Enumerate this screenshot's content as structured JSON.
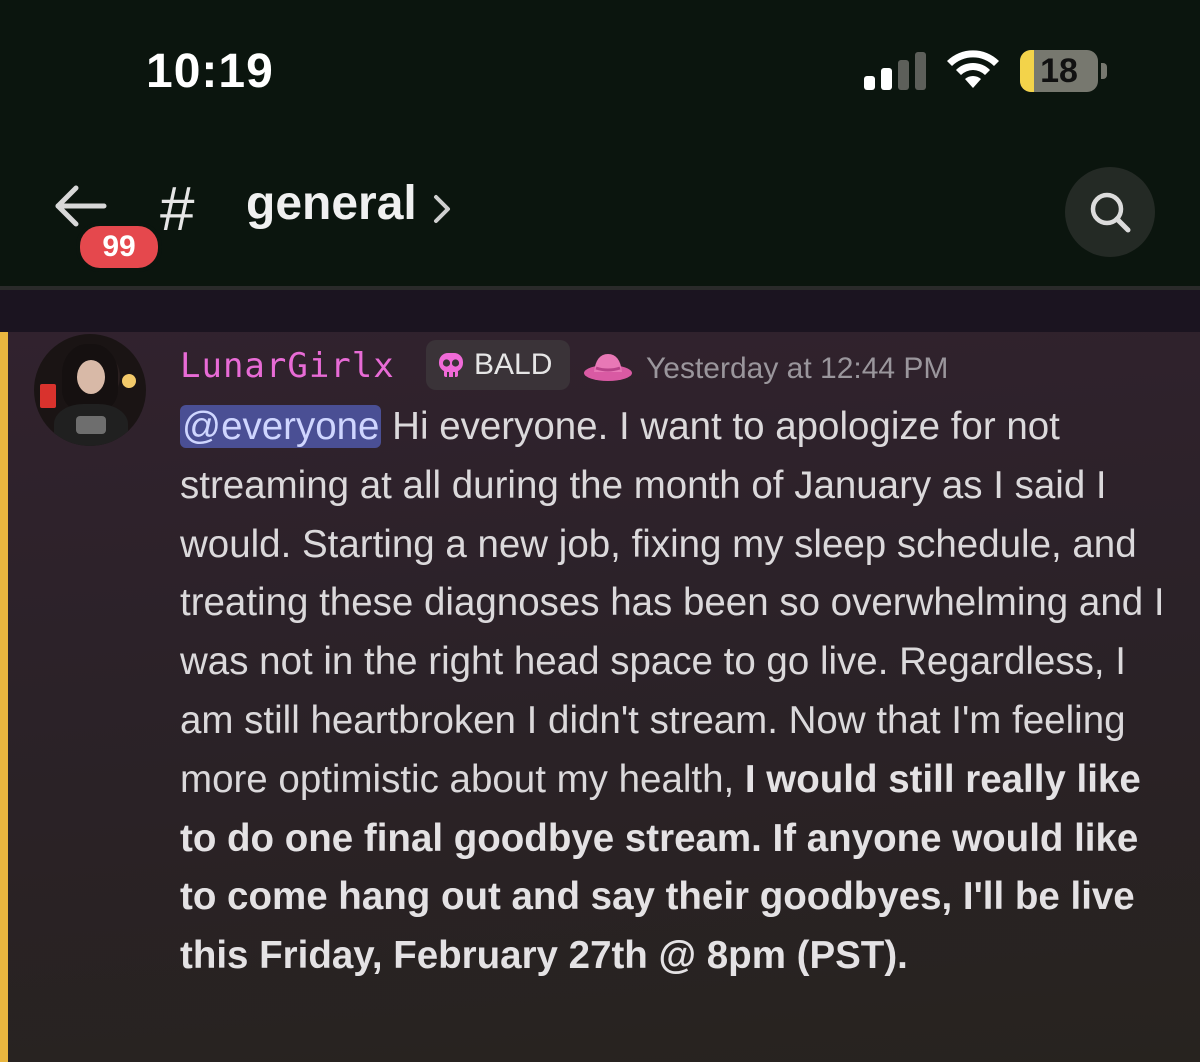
{
  "status_bar": {
    "time": "10:19",
    "battery_percent": "18",
    "signal_bars_active": 2,
    "signal_bars_total": 4
  },
  "header": {
    "unread_badge": "99",
    "channel_hash": "#",
    "channel_name": "general",
    "icons": [
      "back-arrow-icon",
      "chevron-right-icon",
      "search-icon"
    ]
  },
  "message": {
    "username": "LunarGirlx",
    "role_tag": "BALD",
    "timestamp": "Yesterday at 12:44 PM",
    "mention": "@everyone",
    "text_regular": " Hi everyone. I want to apologize for not streaming at all during the month of January as I said I would. Starting a new job, fixing my sleep schedule, and treating these diagnoses has been so overwhelming and I was not in the right head space to go live. Regardless, I am still heartbroken I didn't stream. Now that I'm feeling more optimistic about my health, ",
    "text_bold": "I would still really like to do one final goodbye stream. If anyone would like to come hang out and say their goodbyes, I'll be live this Friday, February 27th @ 8pm (PST).",
    "colors": {
      "username": "#e86bd6",
      "mention_bg": "#4a4f94",
      "highlight_bar": "#e9b63f",
      "badge": "#e5484d"
    }
  }
}
